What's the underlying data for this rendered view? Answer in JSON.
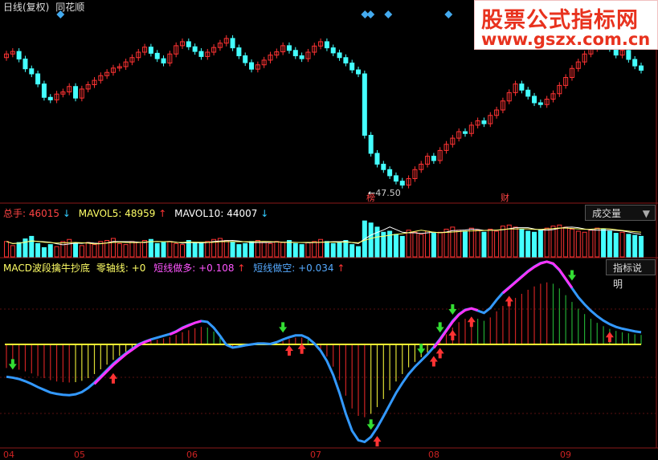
{
  "header": {
    "title": "日线(复权)",
    "source": "同花顺"
  },
  "brand": {
    "line1": "股票公式指标网",
    "line2": "www.gszx.com.cn"
  },
  "price_panel": {
    "low_marker_label": "47.50",
    "event_tags": [
      "榜",
      "财"
    ]
  },
  "volume_panel": {
    "total_label": "总手:",
    "total_value": "46015",
    "total_arrow": "↓",
    "mavol5_label": "MAVOL5:",
    "mavol5_value": "48959",
    "mavol5_arrow": "↑",
    "mavol10_label": "MAVOL10:",
    "mavol10_value": "44007",
    "mavol10_arrow": "↓",
    "dropdown": "成交量"
  },
  "macd_panel": {
    "name": "MACD波段擒牛抄底",
    "zero_label": "零轴线:",
    "zero_value": "+0",
    "long_label": "短线做多:",
    "long_value": "+0.108",
    "long_arrow": "↑",
    "short_label": "短线做空:",
    "short_value": "+0.034",
    "short_arrow": "↑",
    "help_button": "指标说明"
  },
  "x_axis": {
    "labels": [
      "04",
      "05",
      "06",
      "07",
      "08",
      "09"
    ]
  },
  "colors": {
    "up": "#ff3333",
    "down": "#44ffff",
    "zero_line": "#ffff33",
    "long_line": "#ff33ff",
    "short_line": "#3399ff",
    "mavol5": "#ffffff",
    "mavol10": "#ffff66",
    "buy_arrow": "#ff3333",
    "sell_arrow": "#33dd33",
    "hist_red": "#cc2222",
    "hist_green": "#22aa33",
    "hist_yellow": "#dddd33"
  },
  "chart_data": {
    "type": "candlestick",
    "price_close": [
      84.5,
      85.2,
      83.1,
      80.4,
      79.0,
      76.2,
      72.5,
      71.8,
      73.4,
      74.0,
      75.5,
      72.3,
      74.8,
      76.0,
      77.2,
      78.5,
      79.4,
      80.6,
      81.0,
      82.3,
      83.5,
      85.0,
      86.4,
      84.7,
      83.2,
      82.0,
      84.5,
      86.8,
      87.9,
      86.5,
      85.2,
      83.8,
      85.0,
      86.3,
      87.5,
      88.8,
      86.2,
      84.0,
      82.1,
      80.3,
      81.5,
      82.8,
      84.2,
      85.1,
      86.8,
      85.5,
      84.0,
      83.2,
      85.0,
      86.7,
      87.9,
      86.2,
      84.8,
      83.5,
      82.0,
      80.1,
      79.0,
      62.0,
      57.0,
      54.0,
      52.5,
      50.8,
      49.3,
      48.2,
      50.0,
      52.5,
      54.0,
      56.2,
      55.0,
      57.8,
      59.5,
      61.2,
      63.0,
      62.5,
      64.8,
      66.0,
      65.2,
      67.5,
      69.0,
      71.5,
      73.8,
      76.2,
      74.5,
      72.8,
      71.0,
      70.5,
      72.0,
      73.5,
      75.8,
      78.0,
      80.5,
      82.3,
      84.5,
      86.0,
      88.2,
      87.5,
      86.0,
      84.2,
      85.5,
      83.0,
      81.2,
      80.0
    ],
    "macd_long": [
      -0.7,
      -0.72,
      -0.75,
      -0.8,
      -0.86,
      -0.94,
      -1.0,
      -1.06,
      -1.1,
      -1.12,
      -1.13,
      -1.12,
      -1.08,
      -1.0,
      -0.88,
      -0.74,
      -0.6,
      -0.46,
      -0.34,
      -0.22,
      -0.12,
      -0.02,
      0.05,
      0.1,
      0.14,
      0.18,
      0.22,
      0.28,
      0.36,
      0.42,
      0.48,
      0.52,
      0.5,
      0.38,
      0.2,
      0.0,
      -0.06,
      -0.04,
      -0.02,
      0.0,
      0.02,
      0.02,
      0.0,
      0.04,
      0.1,
      0.16,
      0.2,
      0.2,
      0.14,
      0.02,
      -0.14,
      -0.36,
      -0.66,
      -1.06,
      -1.52,
      -1.9,
      -2.12,
      -2.16,
      -2.06,
      -1.86,
      -1.62,
      -1.36,
      -1.1,
      -0.88,
      -0.68,
      -0.52,
      -0.38,
      -0.24,
      -0.08,
      0.1,
      0.3,
      0.5,
      0.66,
      0.76,
      0.8,
      0.76,
      0.7,
      0.8,
      0.98,
      1.14,
      1.26,
      1.38,
      1.5,
      1.62,
      1.72,
      1.8,
      1.84,
      1.8,
      1.66,
      1.46,
      1.26,
      1.06,
      0.9,
      0.76,
      0.64,
      0.54,
      0.46,
      0.4,
      0.36,
      0.33,
      0.3,
      0.28
    ],
    "macd_short": [
      -0.72,
      -0.74,
      -0.77,
      -0.82,
      -0.88,
      -0.95,
      -1.01,
      -1.07,
      -1.1,
      -1.12,
      -1.13,
      -1.11,
      -1.06,
      -0.97,
      -0.85,
      -0.71,
      -0.57,
      -0.43,
      -0.31,
      -0.2,
      -0.1,
      0.0,
      0.06,
      0.11,
      0.15,
      0.19,
      0.23,
      0.29,
      0.37,
      0.43,
      0.48,
      0.52,
      0.5,
      0.37,
      0.19,
      -0.01,
      -0.07,
      -0.05,
      -0.02,
      0.0,
      0.02,
      0.02,
      0.01,
      0.05,
      0.11,
      0.16,
      0.2,
      0.2,
      0.14,
      0.02,
      -0.14,
      -0.37,
      -0.68,
      -1.08,
      -1.54,
      -1.92,
      -2.13,
      -2.17,
      -2.06,
      -1.85,
      -1.6,
      -1.34,
      -1.08,
      -0.86,
      -0.66,
      -0.5,
      -0.36,
      -0.22,
      -0.06,
      0.12,
      0.32,
      0.52,
      0.67,
      0.77,
      0.8,
      0.75,
      0.7,
      0.81,
      0.99,
      1.15,
      1.27,
      1.39,
      1.51,
      1.63,
      1.73,
      1.81,
      1.84,
      1.79,
      1.65,
      1.45,
      1.25,
      1.05,
      0.89,
      0.75,
      0.63,
      0.53,
      0.45,
      0.39,
      0.35,
      0.32,
      0.29,
      0.27
    ],
    "volume": [
      30,
      22,
      28,
      35,
      40,
      26,
      18,
      24,
      20,
      30,
      34,
      26,
      22,
      28,
      24,
      30,
      32,
      36,
      26,
      24,
      30,
      28,
      32,
      34,
      26,
      28,
      30,
      26,
      24,
      32,
      28,
      26,
      30,
      34,
      36,
      32,
      28,
      24,
      26,
      30,
      32,
      28,
      26,
      30,
      28,
      32,
      26,
      24,
      28,
      30,
      34,
      30,
      26,
      28,
      32,
      24,
      20,
      70,
      66,
      58,
      48,
      50,
      44,
      40,
      52,
      48,
      44,
      50,
      46,
      48,
      54,
      58,
      52,
      50,
      56,
      52,
      48,
      54,
      50,
      60,
      62,
      58,
      54,
      50,
      48,
      52,
      56,
      60,
      62,
      58,
      54,
      50,
      48,
      52,
      56,
      54,
      50,
      46,
      48,
      44,
      42,
      40
    ],
    "xlabels": [
      "04",
      "05",
      "06",
      "07",
      "08",
      "09"
    ],
    "buy_signals": [
      17,
      45,
      47,
      59,
      68,
      69,
      71,
      74,
      80,
      96
    ],
    "sell_signals": [
      1,
      44,
      58,
      66,
      69,
      71,
      90,
      103
    ]
  }
}
